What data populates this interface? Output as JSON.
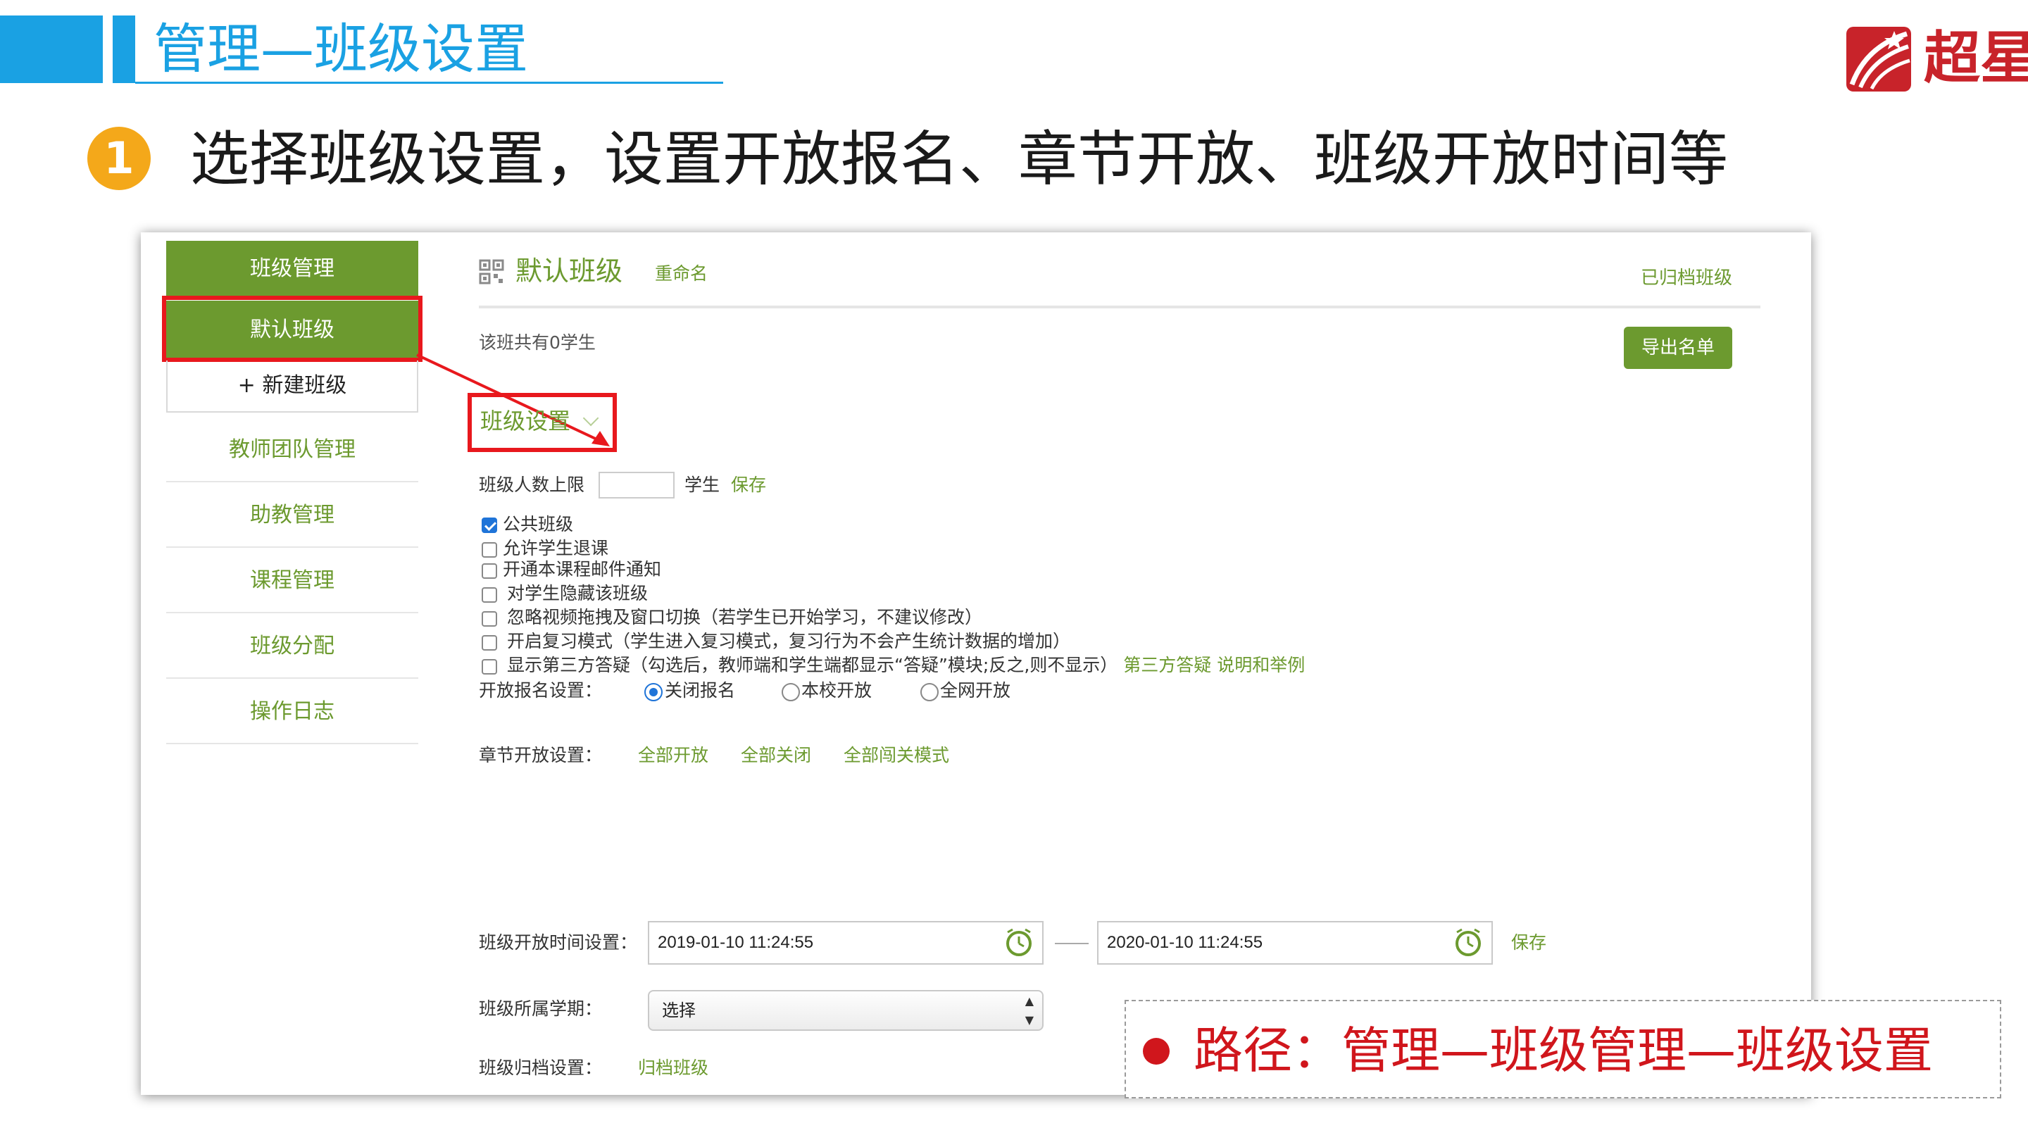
{
  "slide": {
    "title": "管理—班级设置",
    "step_number": "1",
    "step_text": "选择班级设置，设置开放报名、章节开放、班级开放时间等",
    "logo_text": "超星",
    "path_note": "路径：管理—班级管理—班级设置"
  },
  "sidebar": {
    "header": "班级管理",
    "default_class": "默认班级",
    "new_class": "+ 新建班级",
    "items": [
      {
        "label": "教师团队管理"
      },
      {
        "label": "助教管理"
      },
      {
        "label": "课程管理"
      },
      {
        "label": "班级分配"
      },
      {
        "label": "操作日志"
      }
    ]
  },
  "main": {
    "class_name": "默认班级",
    "rename": "重命名",
    "archived_link": "已归档班级",
    "student_count": "该班共有0学生",
    "export_button": "导出名单",
    "settings_title": "班级设置",
    "limit_label": "班级人数上限",
    "limit_value": "",
    "limit_unit": "学生",
    "limit_save": "保存",
    "options": [
      {
        "label": "公共班级",
        "checked": true
      },
      {
        "label": "允许学生退课",
        "checked": false
      },
      {
        "label": "开通本课程邮件通知",
        "checked": false
      },
      {
        "label": "对学生隐藏该班级",
        "checked": false
      },
      {
        "label": "忽略视频拖拽及窗口切换（若学生已开始学习，不建议修改）",
        "checked": false
      },
      {
        "label": "开启复习模式（学生进入复习模式，复习行为不会产生统计数据的增加）",
        "checked": false
      },
      {
        "label": "显示第三方答疑（勾选后，教师端和学生端都显示“答疑”模块;反之,则不显示）",
        "checked": false,
        "link1": "第三方答疑",
        "link2": "说明和举例"
      }
    ],
    "enroll_label": "开放报名设置：",
    "enroll_options": [
      {
        "label": "关闭报名",
        "selected": true
      },
      {
        "label": "本校开放",
        "selected": false
      },
      {
        "label": "全网开放",
        "selected": false
      }
    ],
    "chapter_label": "章节开放设置：",
    "chapter_links": [
      "全部开放",
      "全部关闭",
      "全部闯关模式"
    ],
    "time_label": "班级开放时间设置：",
    "time_start": "2019-01-10 11:24:55",
    "time_end": "2020-01-10 11:24:55",
    "time_save": "保存",
    "term_label": "班级所属学期：",
    "term_value": "选择",
    "archive_label": "班级归档设置：",
    "archive_link": "归档班级"
  },
  "colors": {
    "brand_blue": "#1aa1e3",
    "green": "#6c9a2f",
    "highlight_red": "#e8181d",
    "badge_orange": "#f4a81a"
  }
}
